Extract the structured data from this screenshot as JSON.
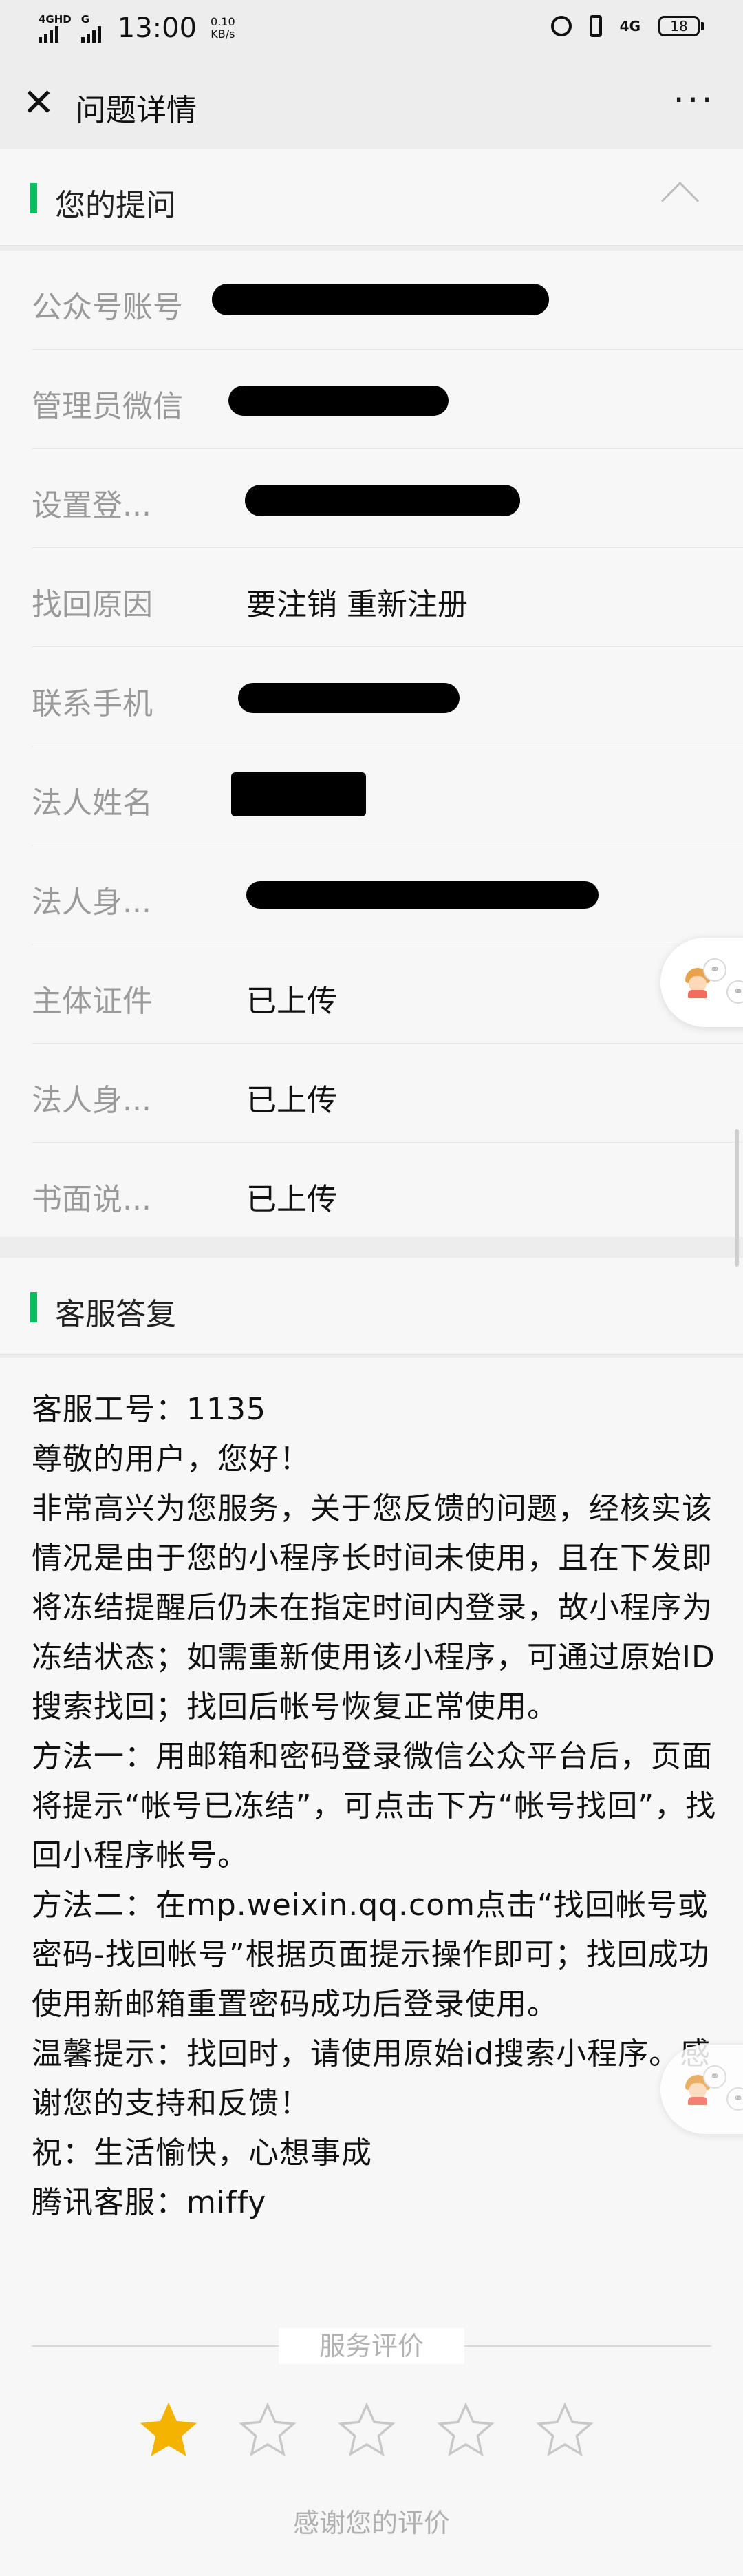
{
  "status_bar": {
    "network_left_1": "4GHD",
    "network_left_2": "G",
    "time": "13:00",
    "speed_value": "0.10",
    "speed_unit": "KB/s",
    "network_right": "4G",
    "battery": "18"
  },
  "nav": {
    "close_icon": "close-icon",
    "title": "问题详情",
    "more_icon": "ellipsis-icon"
  },
  "question_section": {
    "title": "您的提问",
    "chevron_icon": "chevron-up-icon",
    "fields": [
      {
        "label": "公众号账号",
        "value": "",
        "redacted": true
      },
      {
        "label": "管理员微信",
        "value": "",
        "redacted": true
      },
      {
        "label": "设置登...",
        "value": "",
        "redacted": true
      },
      {
        "label": "找回原因",
        "value": "要注销 重新注册",
        "redacted": false
      },
      {
        "label": "联系手机",
        "value": "",
        "redacted": true
      },
      {
        "label": "法人姓名",
        "value": "",
        "redacted": true
      },
      {
        "label": "法人身...",
        "value": "",
        "redacted": true
      },
      {
        "label": "主体证件",
        "value": "已上传",
        "redacted": false
      },
      {
        "label": "法人身...",
        "value": "已上传",
        "redacted": false
      },
      {
        "label": "书面说...",
        "value": "已上传",
        "redacted": false
      }
    ]
  },
  "reply_section": {
    "title": "客服答复",
    "text": "客服工号：1135\n尊敬的用户，您好！\n非常高兴为您服务，关于您反馈的问题，经核实该情况是由于您的小程序长时间未使用，且在下发即将冻结提醒后仍未在指定时间内登录，故小程序为冻结状态；如需重新使用该小程序，可通过原始ID搜索找回；找回后帐号恢复正常使用。\n方法一：用邮箱和密码登录微信公众平台后，页面将提示“帐号已冻结”，可点击下方“帐号找回”，找回小程序帐号。\n方法二：在mp.weixin.qq.com点击“找回帐号或密码-找回帐号”根据页面提示操作即可；找回成功使用新邮箱重置密码成功后登录使用。\n温馨提示：找回时，请使用原始id搜索小程序。感谢您的支持和反馈！\n祝：生活愉快，心想事成\n腾讯客服：miffy"
  },
  "rating": {
    "label": "服务评价",
    "stars_total": 5,
    "stars_selected": 1,
    "thanks": "感谢您的评价",
    "filled_color": "#f5b301",
    "empty_color": "#c8c8c8"
  },
  "floating_widget": {
    "icon": "customer-service-avatar-icon"
  },
  "colors": {
    "accent": "#07c160",
    "background": "#ededed",
    "card": "#f7f7f7"
  }
}
